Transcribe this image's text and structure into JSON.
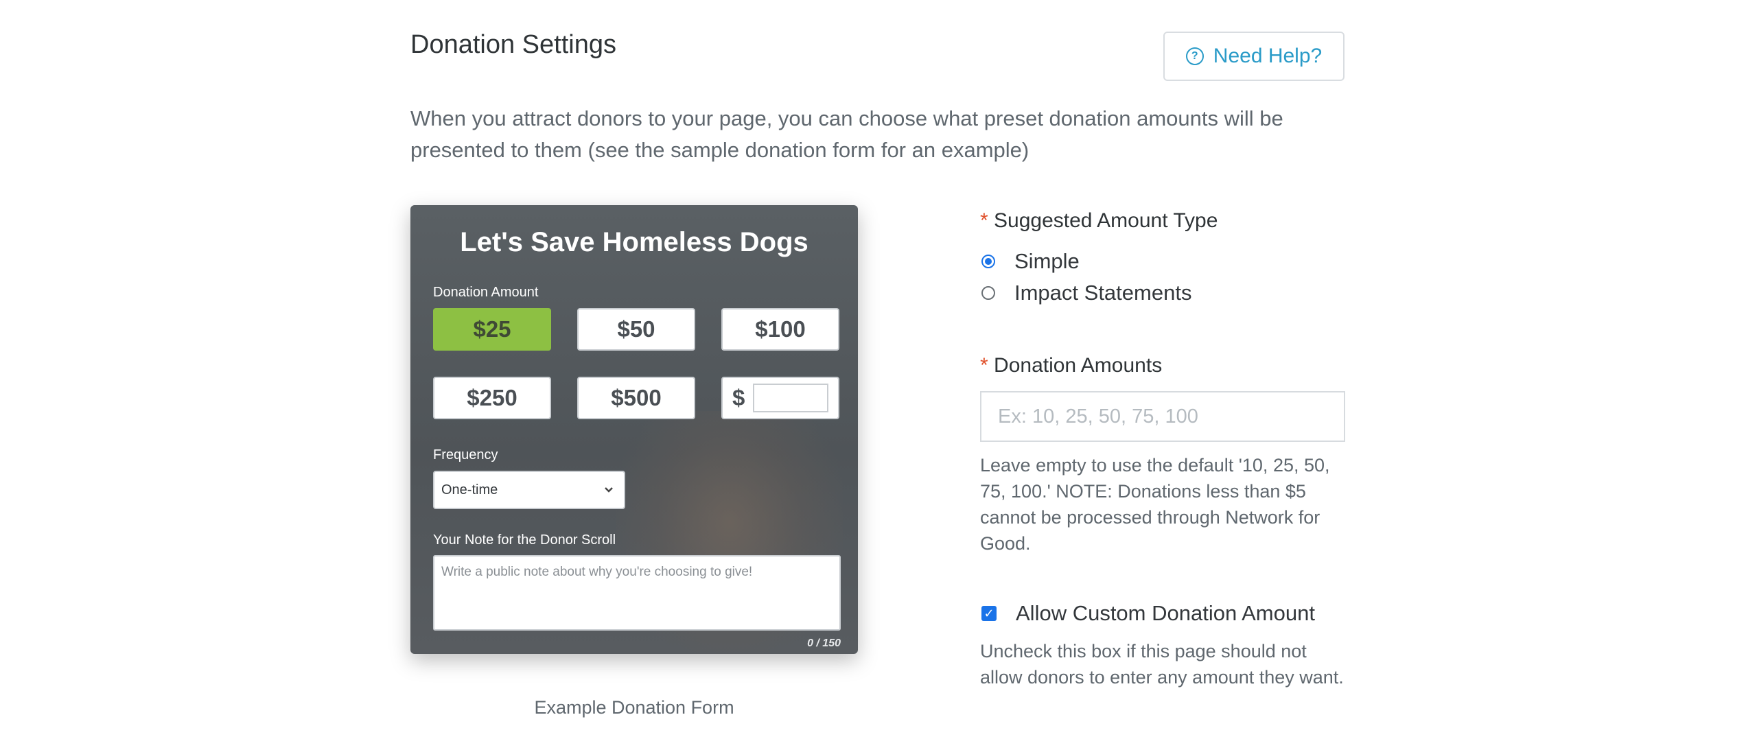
{
  "header": {
    "title": "Donation Settings",
    "help_label": "Need Help?",
    "help_icon": "?"
  },
  "intro": "When you attract donors to your page, you can choose what preset donation amounts will be presented to them (see the sample donation form for an example)",
  "example_form": {
    "title": "Let's Save Homeless Dogs",
    "amount_label": "Donation Amount",
    "amounts": [
      "$25",
      "$50",
      "$100",
      "$250",
      "$500"
    ],
    "selected_amount": "$25",
    "custom_prefix": "$",
    "frequency_label": "Frequency",
    "frequency_value": "One-time",
    "note_label": "Your Note for the Donor Scroll",
    "note_placeholder": "Write a public note about why you're choosing to give!",
    "note_counter": "0 / 150",
    "caption": "Example Donation Form",
    "accent_color": "#8dc043"
  },
  "settings": {
    "required_mark": "*",
    "amount_type_label": "Suggested Amount Type",
    "amount_type_options": [
      "Simple",
      "Impact Statements"
    ],
    "amount_type_selected": "Simple",
    "donation_amounts_label": "Donation Amounts",
    "donation_amounts_placeholder": "Ex: 10, 25, 50, 75, 100",
    "donation_amounts_help": "Leave empty to use the default '10, 25, 50, 75, 100.' NOTE: Donations less than $5 cannot be processed through Network for Good.",
    "allow_custom_label": "Allow Custom Donation Amount",
    "allow_custom_checked": true,
    "allow_custom_help": "Uncheck this box if this page should not allow donors to enter any amount they want."
  },
  "colors": {
    "link": "#2a9bc8",
    "required": "#e0522d",
    "control": "#1a73e8"
  }
}
